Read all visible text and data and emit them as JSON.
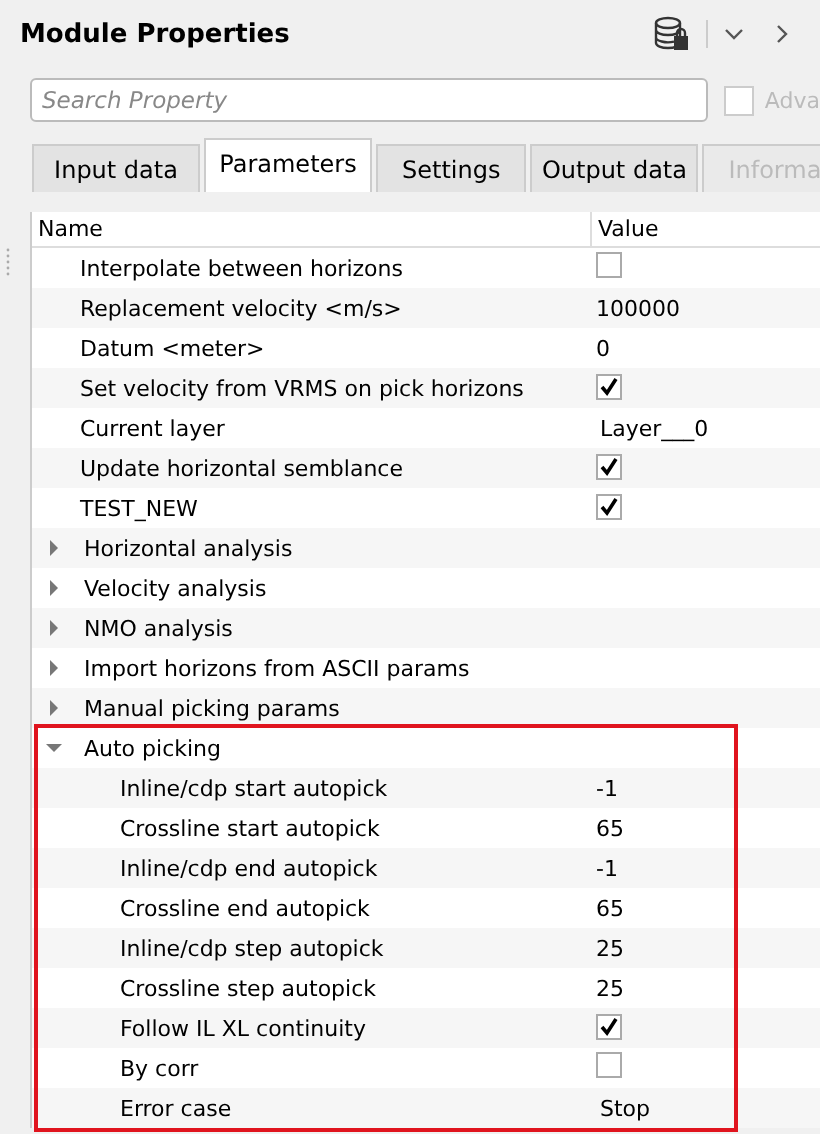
{
  "window": {
    "title": "Module Properties"
  },
  "search": {
    "placeholder": "Search Property"
  },
  "advanced": {
    "label": "Adva",
    "checked": false
  },
  "tabs": [
    {
      "label": "Input data",
      "selected": false,
      "disabled": false
    },
    {
      "label": "Parameters",
      "selected": true,
      "disabled": false
    },
    {
      "label": "Settings",
      "selected": false,
      "disabled": false
    },
    {
      "label": "Output data",
      "selected": false,
      "disabled": false
    },
    {
      "label": "Informa",
      "selected": false,
      "disabled": true
    }
  ],
  "table": {
    "columns": [
      "Name",
      "Value"
    ],
    "rows": [
      {
        "kind": "check",
        "name": "Interpolate between horizons",
        "checked": false
      },
      {
        "kind": "text",
        "name": "Replacement velocity <m/s>",
        "value": "100000"
      },
      {
        "kind": "text",
        "name": "Datum <meter>",
        "value": "0"
      },
      {
        "kind": "check",
        "name": "Set velocity from VRMS on pick horizons",
        "checked": true
      },
      {
        "kind": "choice",
        "name": "Current layer",
        "value": "Layer___0"
      },
      {
        "kind": "check",
        "name": "Update horizontal semblance",
        "checked": true
      },
      {
        "kind": "check",
        "name": "TEST_NEW",
        "checked": true
      },
      {
        "kind": "group",
        "name": "Horizontal analysis",
        "expanded": false,
        "highlighted": false
      },
      {
        "kind": "group",
        "name": "Velocity analysis",
        "expanded": false,
        "highlighted": false
      },
      {
        "kind": "group",
        "name": "NMO analysis",
        "expanded": false,
        "highlighted": false
      },
      {
        "kind": "group",
        "name": "Import horizons from ASCII params",
        "expanded": false,
        "highlighted": false
      },
      {
        "kind": "group",
        "name": "Manual picking params",
        "expanded": false,
        "highlighted": false
      },
      {
        "kind": "group",
        "name": "Auto picking",
        "expanded": true,
        "highlighted": true,
        "children": [
          {
            "kind": "text",
            "name": "Inline/cdp start autopick",
            "value": "-1"
          },
          {
            "kind": "text",
            "name": "Crossline start autopick",
            "value": "65"
          },
          {
            "kind": "text",
            "name": "Inline/cdp end autopick",
            "value": "-1"
          },
          {
            "kind": "text",
            "name": "Crossline end autopick",
            "value": "65"
          },
          {
            "kind": "text",
            "name": "Inline/cdp step autopick",
            "value": "25"
          },
          {
            "kind": "text",
            "name": "Crossline step autopick",
            "value": "25"
          },
          {
            "kind": "check",
            "name": "Follow IL XL continuity",
            "checked": true
          },
          {
            "kind": "check",
            "name": "By corr",
            "checked": false
          },
          {
            "kind": "choice",
            "name": "Error case",
            "value": "Stop"
          }
        ]
      }
    ]
  }
}
